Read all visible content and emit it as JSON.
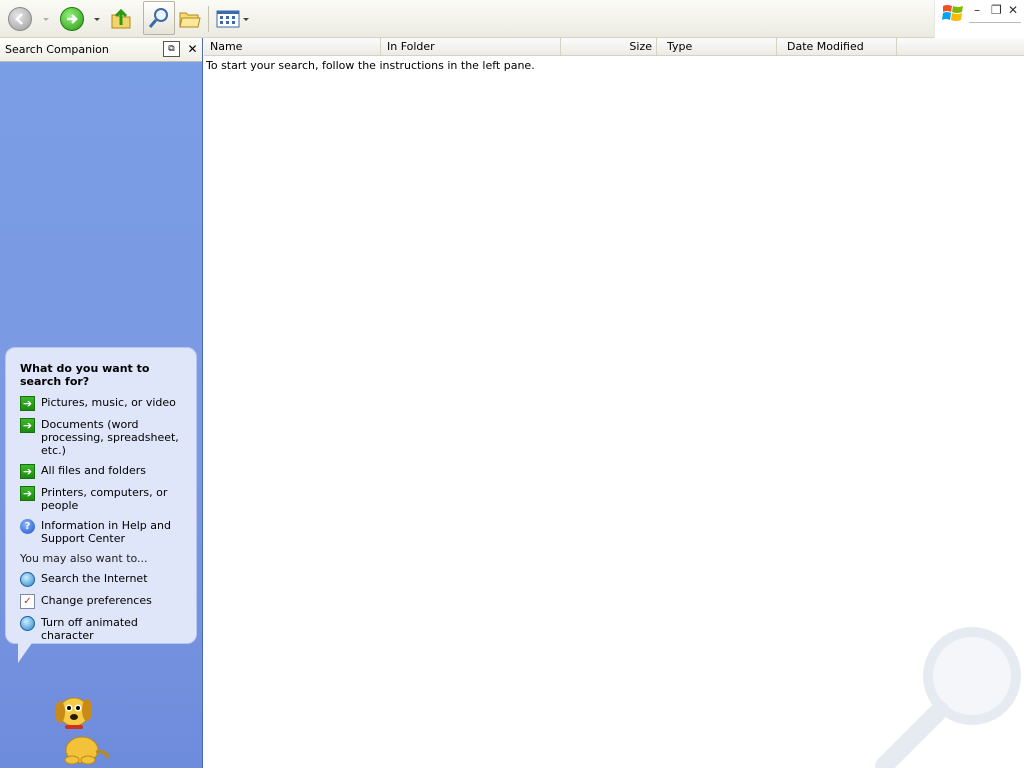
{
  "left_pane": {
    "title": "Search Companion",
    "heading": "What do you want to search for?",
    "options": [
      {
        "label": "Pictures, music, or video",
        "icon": "green-arrow-icon"
      },
      {
        "label": "Documents (word processing, spreadsheet, etc.)",
        "icon": "green-arrow-icon"
      },
      {
        "label": "All files and folders",
        "icon": "green-arrow-icon"
      },
      {
        "label": "Printers, computers, or people",
        "icon": "green-arrow-icon"
      },
      {
        "label": "Information in Help and Support Center",
        "icon": "help-icon"
      }
    ],
    "also_label": "You may also want to...",
    "also_options": [
      {
        "label": "Search the Internet",
        "icon": "globe-search-icon"
      },
      {
        "label": "Change preferences",
        "icon": "preferences-icon"
      },
      {
        "label": "Turn off animated character",
        "icon": "globe-icon"
      }
    ]
  },
  "columns": [
    "Name",
    "In Folder",
    "Size",
    "Type",
    "Date Modified"
  ],
  "message": "To start your search, follow the instructions in the left pane."
}
